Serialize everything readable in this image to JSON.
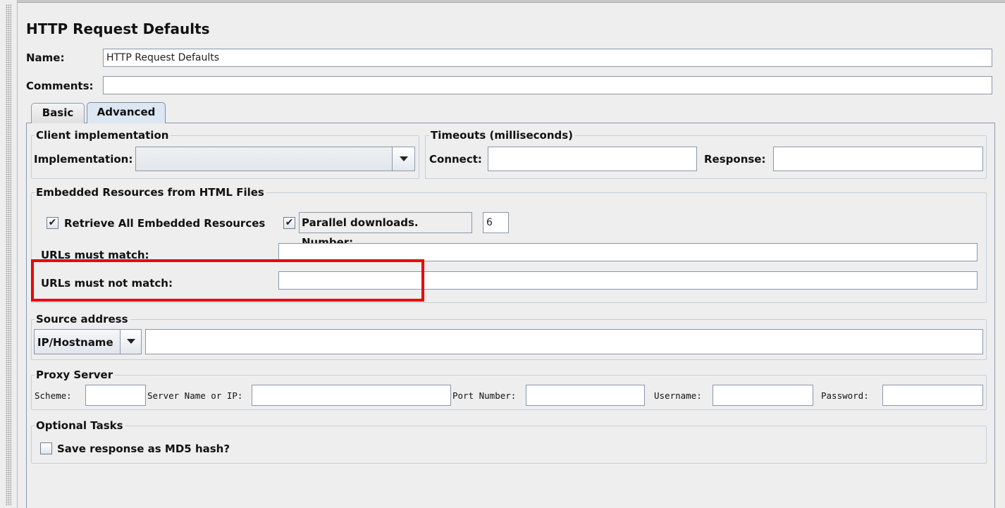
{
  "title": "HTTP Request Defaults",
  "name": {
    "label": "Name:",
    "value": "HTTP Request Defaults"
  },
  "comments": {
    "label": "Comments:",
    "value": ""
  },
  "tabs": [
    {
      "label": "Basic"
    },
    {
      "label": "Advanced"
    }
  ],
  "active_tab": "Advanced",
  "client": {
    "legend": "Client implementation",
    "implementation_label": "Implementation:",
    "implementation_value": ""
  },
  "timeouts": {
    "legend": "Timeouts (milliseconds)",
    "connect_label": "Connect:",
    "connect_value": "",
    "response_label": "Response:",
    "response_value": ""
  },
  "embedded": {
    "legend": "Embedded Resources from HTML Files",
    "retrieve_label": "Retrieve All Embedded Resources",
    "retrieve_checked": true,
    "parallel_label": "Parallel downloads. Number:",
    "parallel_checked": true,
    "parallel_value": "6",
    "urls_match_label": "URLs must match:",
    "urls_match_value": "",
    "urls_not_match_label": "URLs must not match:",
    "urls_not_match_value": ""
  },
  "source": {
    "legend": "Source address",
    "type_value": "IP/Hostname",
    "address_value": ""
  },
  "proxy": {
    "legend": "Proxy Server",
    "scheme_label": "Scheme:",
    "server_label": "Server Name or IP:",
    "port_label": "Port Number:",
    "username_label": "Username:",
    "password_label": "Password:"
  },
  "optional": {
    "legend": "Optional Tasks",
    "md5_label": "Save response as MD5 hash?",
    "md5_checked": false
  },
  "colors": {
    "highlight": "#ee0000",
    "panel": "#eeeeee",
    "tab_active": "#dde7f3"
  },
  "icons": {
    "checkbox_checked": "✔",
    "dropdown": "chevron-down-icon"
  }
}
